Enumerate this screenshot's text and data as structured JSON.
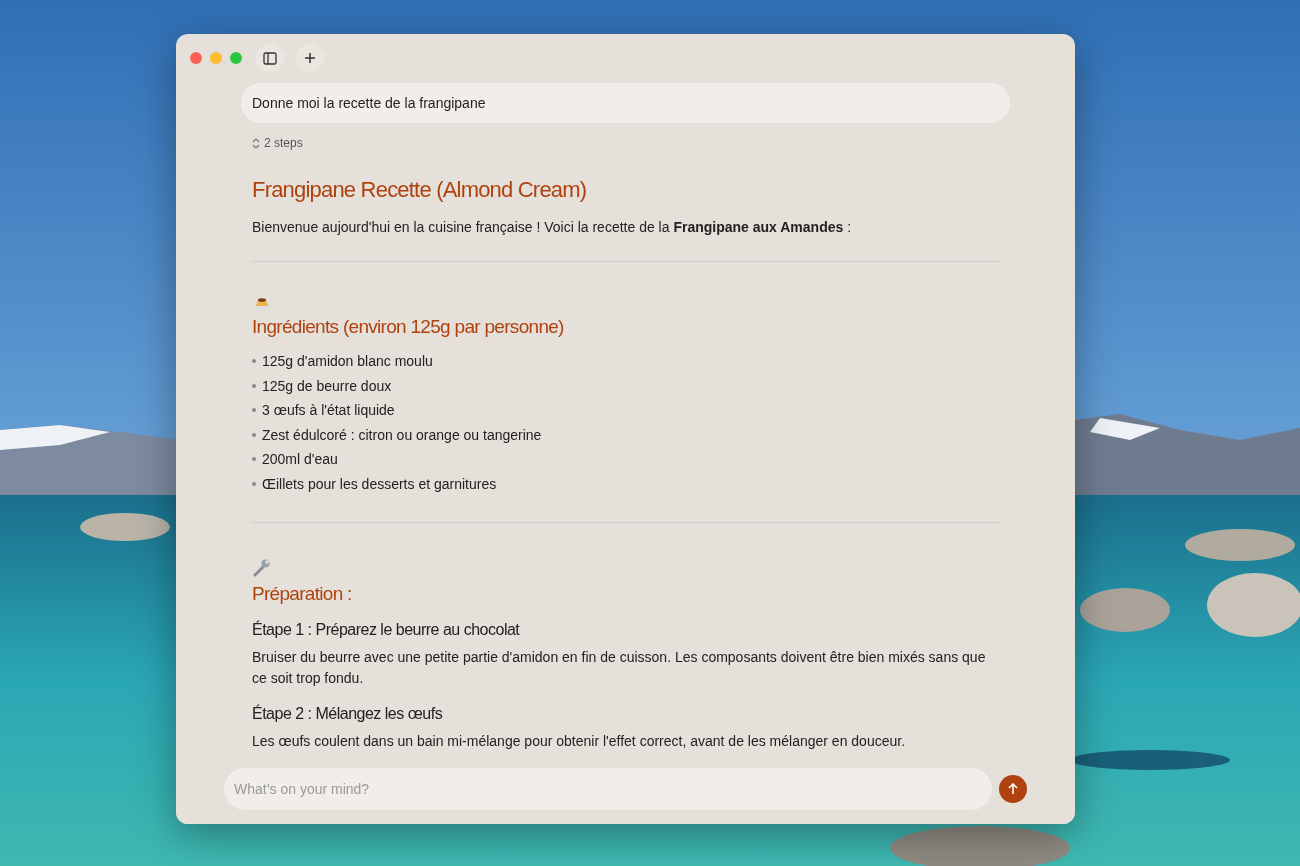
{
  "window": {
    "toolbar": [
      {
        "kind": "sidebar"
      },
      {
        "kind": "new"
      }
    ]
  },
  "prompt": "Donne moi la recette de la frangipane",
  "steps_toggle": "2 steps",
  "answer": {
    "title": "Frangipane Recette (Almond Cream)",
    "intro": "Bienvenue aujourd'hui en la cuisine française ! Voici la recette de la **Frangipane aux Amandes** :",
    "sections": [
      {
        "kind": "list",
        "heading": "Ingrédients (environ 125g par personne)",
        "items": [
          "125g d'amidon blanc moulu",
          "125g de beurre doux",
          "3 œufs à l'état liquide",
          "Zest édulcoré : citron ou orange ou tangerine",
          "200ml d'eau",
          "Œillets pour les desserts et garnitures"
        ]
      },
      {
        "kind": "steps",
        "heading": "Préparation :",
        "steps": [
          {
            "title": "Étape 1 : Préparez le beurre au chocolat",
            "text": "Bruiser du beurre avec une petite partie d'amidon en fin de cuisson. Les composants doivent être bien mixés sans que ce soit trop fondu."
          },
          {
            "title": "Étape 2 : Mélangez les œufs",
            "text": "Les œufs coulent dans un bain mi-mélange pour obtenir l'effet correct, avant de les mélanger en douceur."
          }
        ]
      }
    ]
  },
  "composer": {
    "placeholder": "What’s on your mind?"
  }
}
